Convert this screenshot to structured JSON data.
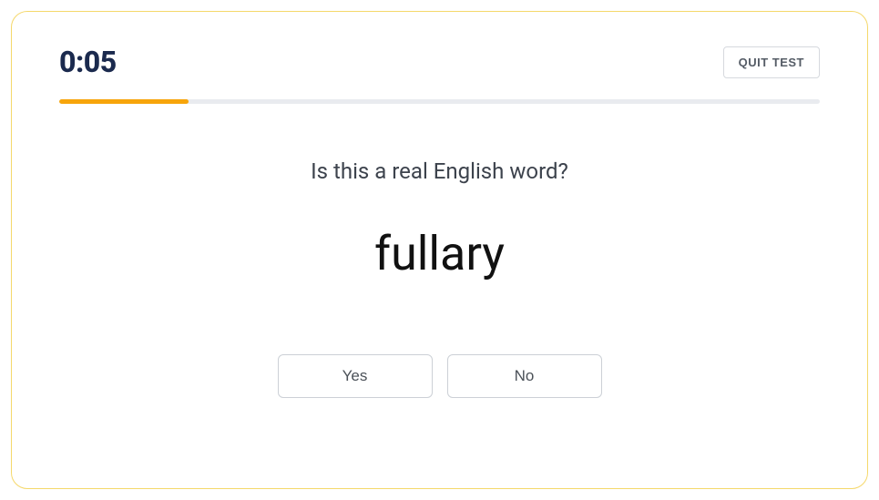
{
  "timer": "0:05",
  "quit_label": "QUIT TEST",
  "progress_percent": 17,
  "prompt": "Is this a real English word?",
  "word": "fullary",
  "answers": {
    "yes": "Yes",
    "no": "No"
  }
}
